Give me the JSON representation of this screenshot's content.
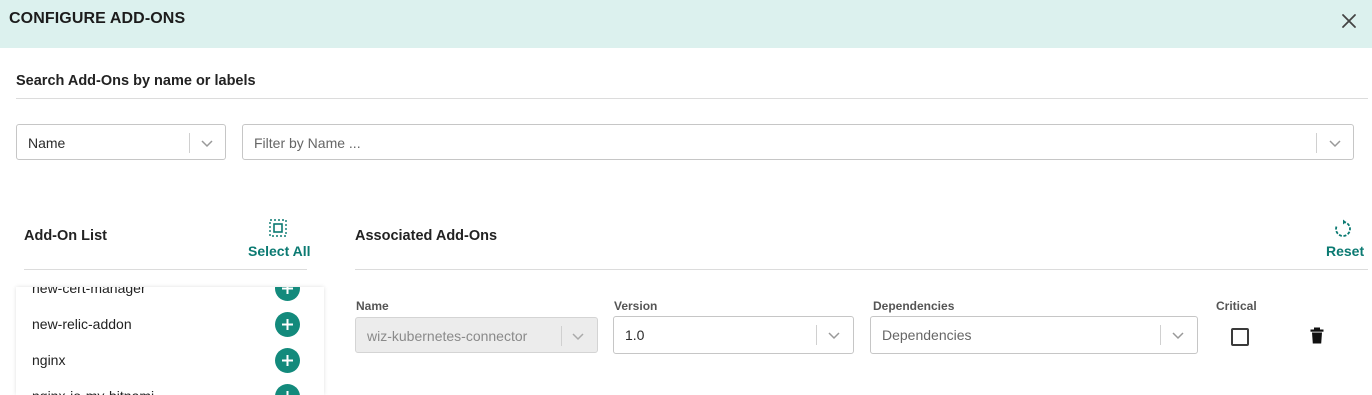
{
  "dialog": {
    "title": "CONFIGURE ADD-ONS",
    "close_icon": "close-icon"
  },
  "search": {
    "heading": "Search Add-Ons by name or labels",
    "filter_type": {
      "value": "Name"
    },
    "filter_input": {
      "placeholder": "Filter by Name ..."
    }
  },
  "addon_list": {
    "heading": "Add-On List",
    "select_all_label": "Select All",
    "items": [
      {
        "label": "new-cert-manager"
      },
      {
        "label": "new-relic-addon"
      },
      {
        "label": "nginx"
      },
      {
        "label": "nginx-io-my-bitnami"
      }
    ],
    "add_icon": "plus-circle-icon"
  },
  "associated": {
    "heading": "Associated Add-Ons",
    "reset_label": "Reset",
    "columns": {
      "name": "Name",
      "version": "Version",
      "dependencies": "Dependencies",
      "critical": "Critical"
    },
    "rows": [
      {
        "name": "wiz-kubernetes-connector",
        "version": "1.0",
        "dependencies_placeholder": "Dependencies",
        "critical": false
      }
    ]
  },
  "colors": {
    "header_bg": "#dcf1ee",
    "accent": "#0b7a72",
    "add_button": "#138a7c"
  }
}
